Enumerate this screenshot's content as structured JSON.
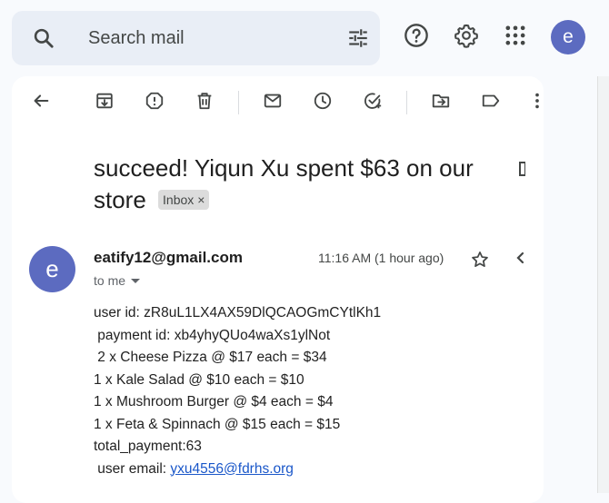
{
  "search": {
    "placeholder": "Search mail",
    "icon": "search-icon",
    "filter_icon": "tune-icon"
  },
  "header": {
    "help_icon": "help-icon",
    "settings_icon": "gear-icon",
    "apps_icon": "apps-grid-icon",
    "avatar_letter": "e",
    "avatar_color": "#5c6bc0"
  },
  "toolbar": [
    "back-icon",
    "archive-icon",
    "report-spam-icon",
    "delete-icon",
    "mark-unread-icon",
    "snooze-icon",
    "add-task-icon",
    "move-to-icon",
    "label-icon",
    "more-icon"
  ],
  "message": {
    "subject": "succeed! Yiqun Xu spent $63 on our store",
    "label": "Inbox",
    "label_close": "×",
    "sender_avatar_letter": "e",
    "sender_email": "eatify12@gmail.com",
    "time": "11:16 AM (1 hour ago)",
    "to_me": "to me",
    "body": [
      "user id: zR8uL1LX4AX59DlQCAOGmCYtlKh1",
      " payment id: xb4yhyQUo4waXs1ylNot",
      " 2 x Cheese Pizza @ $17 each = $34",
      "1 x Kale Salad @ $10 each = $10",
      "1 x Mushroom Burger @ $4 each = $4",
      "1 x Feta & Spinnach @ $15 each = $15",
      "total_payment:63"
    ],
    "user_email_label": " user email: ",
    "user_email": "yxu4556@fdrhs.org"
  },
  "colors": {
    "accent": "#5c6bc0",
    "link": "#1a57c9",
    "search_bg": "#e9eef6",
    "page_bg": "#f8fafd"
  }
}
